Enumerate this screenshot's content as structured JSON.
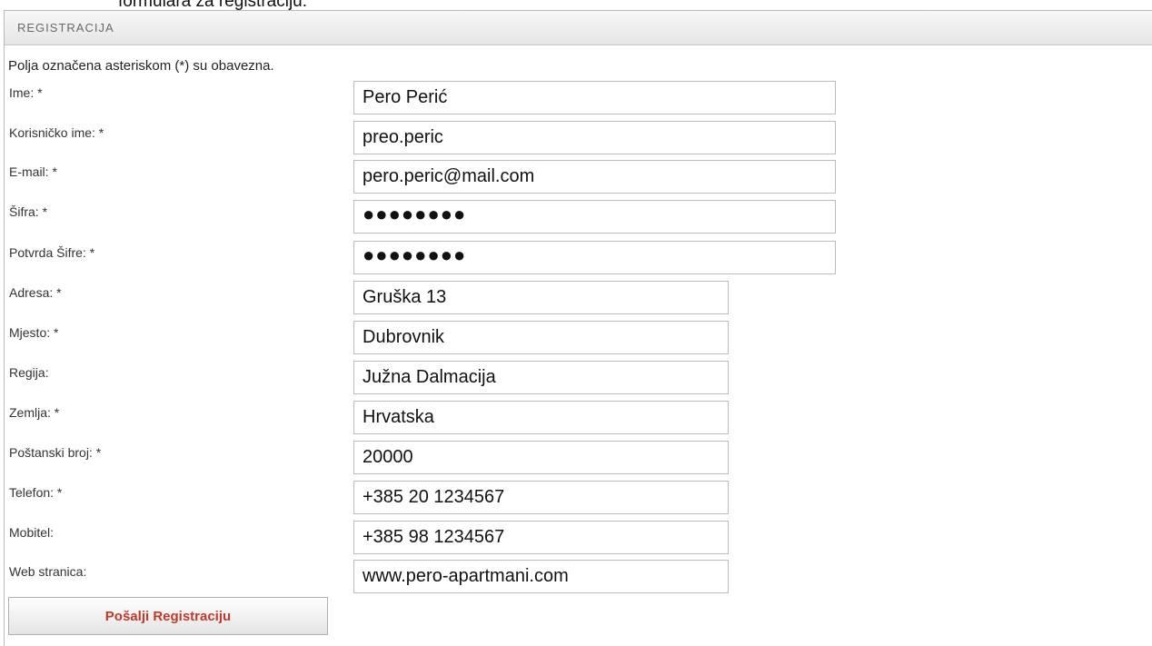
{
  "page": {
    "caption": "formulara za registraciju."
  },
  "panel": {
    "title": "REGISTRACIJA",
    "note": "Polja označena asteriskom (*) su obavezna."
  },
  "form": {
    "ime": {
      "label": "Ime: *",
      "value": "Pero Perić"
    },
    "korisnicko_ime": {
      "label": "Korisničko ime: *",
      "value": "preo.peric"
    },
    "email": {
      "label": "E-mail: *",
      "value": "pero.peric@mail.com"
    },
    "sifra": {
      "label": "Šifra: *",
      "value": "●●●●●●●●"
    },
    "potvrda_sifre": {
      "label": "Potvrda Šifre: *",
      "value": "●●●●●●●●"
    },
    "adresa": {
      "label": "Adresa: *",
      "value": "Gruška 13"
    },
    "mjesto": {
      "label": "Mjesto: *",
      "value": "Dubrovnik"
    },
    "regija": {
      "label": "Regija:",
      "value": "Južna Dalmacija"
    },
    "zemlja": {
      "label": "Zemlja: *",
      "value": "Hrvatska"
    },
    "postanski_broj": {
      "label": "Poštanski broj: *",
      "value": "20000"
    },
    "telefon": {
      "label": "Telefon: *",
      "value": "+385 20 1234567"
    },
    "mobitel": {
      "label": "Mobitel:",
      "value": "+385 98 1234567"
    },
    "web_stranica": {
      "label": "Web stranica:",
      "value": "www.pero-apartmani.com"
    },
    "submit_label": "Pošalji Registraciju"
  }
}
